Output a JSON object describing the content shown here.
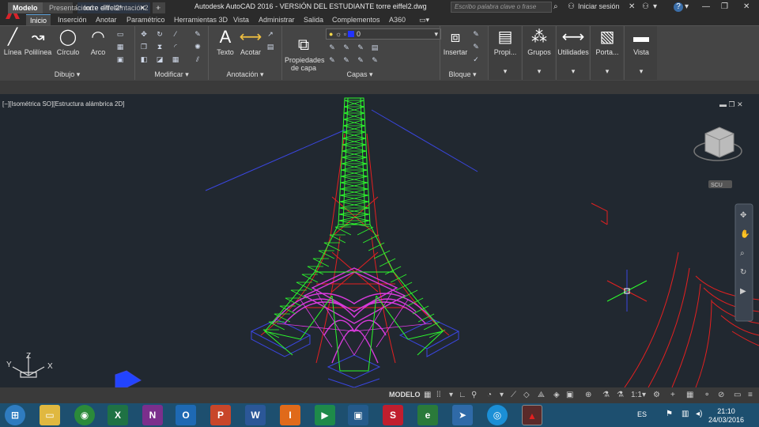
{
  "title_bar": {
    "title": "Autodesk AutoCAD 2016 -  VERSIÓN DEL ESTUDIANTE    torre eiffel2.dwg",
    "search_placeholder": "Escribo palabra clave o frase",
    "signin_label": "Iniciar sesión"
  },
  "menu_tabs": [
    "Inicio",
    "Inserción",
    "Anotar",
    "Paramétrico",
    "Herramientas 3D",
    "Vista",
    "Administrar",
    "Salida",
    "Complementos",
    "A360"
  ],
  "ribbon": {
    "draw_tools": [
      "Línea",
      "Polilínea",
      "Círculo",
      "Arco"
    ],
    "panels": {
      "dibujo": "Dibujo",
      "modificar": "Modificar",
      "anotacion": "Anotación",
      "capas": "Capas",
      "bloque": "Bloque"
    },
    "texto": "Texto",
    "acotar": "Acotar",
    "propiedades_capa": "Propiedades\nde capa",
    "layer_value": "0",
    "insertar": "Insertar",
    "right_panels": [
      "Propi...",
      "Grupos",
      "Utilidades",
      "Porta...",
      "Vista"
    ]
  },
  "doc_tabs": {
    "start": "Inicio",
    "file": "torre eiffel2*"
  },
  "viewport": {
    "label": "[−][Isométrica SO][Estructura alámbrica 2D]",
    "ucs_label": "SCU",
    "viewcube_label": "SUPERIOR"
  },
  "layout_tabs": [
    "Modelo",
    "Presentación1",
    "Presentación2"
  ],
  "status_bar": {
    "space": "MODELO",
    "scale": "1:1"
  },
  "taskbar": {
    "language": "ES",
    "time": "21:10",
    "date": "24/03/2016"
  },
  "colors": {
    "viewport_bg": "#212830",
    "tower_green": "#2dfc2d",
    "tower_magenta": "#e23ce6",
    "red_lines": "#e52020",
    "blue_lines": "#3a46e0",
    "taskbar": "#1d4f6f"
  }
}
